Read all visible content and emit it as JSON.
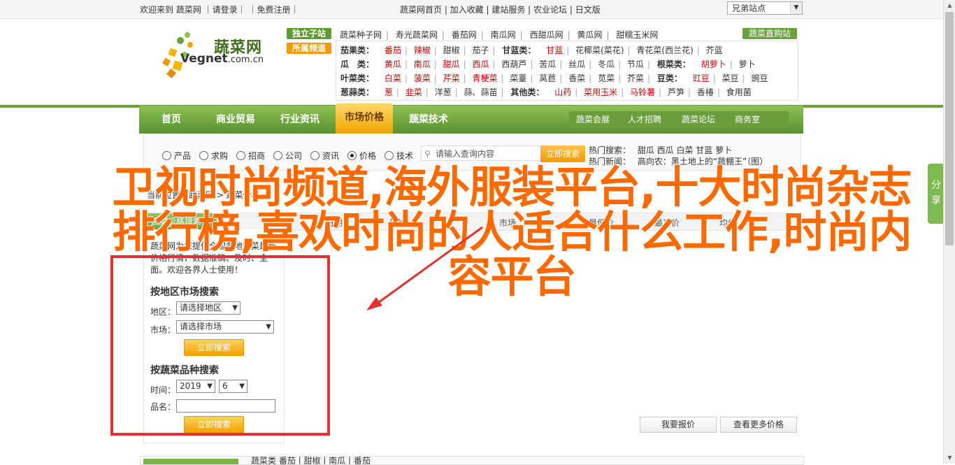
{
  "topbar": {
    "welcome": "欢迎来到 蔬菜网 ｜请登录｜ ｜免费注册｜",
    "links": "蔬菜网首页 | 加入收藏 | 建站服务 | 农业论坛 | 日文版",
    "lang_select": "兄弟站点"
  },
  "header": {
    "logo_cn": "蔬菜网",
    "logo_en_1": "Vegnet",
    "logo_en_2": ".com.cn",
    "tag_1": "独立子站",
    "tag_2": "所属频道",
    "top_links": [
      "蔬菜种子网",
      "寿光蔬菜网",
      "番茄网",
      "南瓜网",
      "西甜瓜网",
      "黄瓜网",
      "甜糯玉米网"
    ],
    "direct_button": "蔬菜直购站",
    "categories": [
      {
        "head": "茄果类：",
        "items": [
          "番茄",
          "辣椒",
          "甜椒",
          "茄子"
        ],
        "head2": "甘蓝类：",
        "items2": [
          "甘蓝",
          "花椰菜(菜花)",
          "青花菜(西兰花)",
          "芥蓝"
        ]
      },
      {
        "head": "瓜　类：",
        "items": [
          "黄瓜",
          "南瓜",
          "甜瓜",
          "西瓜",
          "西葫芦",
          "苦瓜",
          "丝瓜",
          "冬瓜",
          "节瓜"
        ],
        "head2": "根菜类：",
        "items2": [
          "胡萝卜",
          "萝卜"
        ]
      },
      {
        "head": "叶菜类：",
        "items": [
          "白菜",
          "菠菜",
          "芹菜",
          "青梗菜",
          "菜薹",
          "莴苣",
          "香菜",
          "苋菜",
          "芥菜"
        ],
        "head2": "豆类：",
        "items2": [
          "豇豆",
          "菜豆",
          "豌豆"
        ]
      },
      {
        "head": "葱蒜类：",
        "items": [
          "葱",
          "韭菜",
          "洋葱",
          "蒜、蒜苗"
        ],
        "head2": "其他类：",
        "items2": [
          "山药",
          "菜用玉米",
          "马铃薯",
          "芦笋",
          "香椿",
          "食用菌"
        ]
      }
    ]
  },
  "nav": {
    "items": [
      "首页",
      "商业贸易",
      "行业资讯",
      "市场价格",
      "蔬菜技术"
    ],
    "sub": [
      "蔬菜会展",
      "人才招聘",
      "蔬菜论坛",
      "商务室"
    ]
  },
  "search": {
    "options": [
      "产品",
      "求购",
      "招商",
      "公司",
      "资讯",
      "价格",
      "技术"
    ],
    "selected": "价格",
    "placeholder": "请输入查询内容",
    "button": "立即搜索",
    "hot_label": "热门搜索：",
    "hot_items": "甜瓜  西瓜  白菜  甘蓝  萝卜",
    "news_label": "热门新闻：",
    "news_item": "高向农：黑土地上的“蔬棚王”（图）"
  },
  "breadcrumb": "当前位置：蔬菜网 > 蔬菜价格",
  "tabbar": {
    "title": "蔬菜价格搜索",
    "columns": [
      "日期",
      "品种",
      "市场",
      "最低价",
      "最高价",
      "均价"
    ]
  },
  "leftpanel": {
    "intro": "蔬菜网为您提供全国各地蔬菜最新价格行情，数据准确、及时、全面。欢迎各界人士使用！",
    "region_header": "按地区市场搜索",
    "region_label": "地区：",
    "region_value": "请选择地区",
    "market_label": "市场：",
    "market_value": "请选择市场",
    "btn": "立即搜索",
    "variety_header": "按蔬菜品种搜索",
    "time_label": "时间：",
    "year": "2019",
    "month": "6",
    "name_label": "品名：",
    "btn2": "立即搜索"
  },
  "right_buttons": [
    "我要报价",
    "查看更多价格"
  ],
  "bottom": {
    "text": "蔬菜类   番茄  |  甜椒  |  南瓜  |  番茄"
  },
  "share": "分享",
  "overlay_title": "卫视时尚频道,海外服装平台,十大时尚杂志排行榜,喜欢时尚的人适合什么工作,时尚内容平台",
  "colors": {
    "brand_green": "#6aa13b",
    "accent_orange": "#ff6a00",
    "highlight_red": "#e53030"
  }
}
